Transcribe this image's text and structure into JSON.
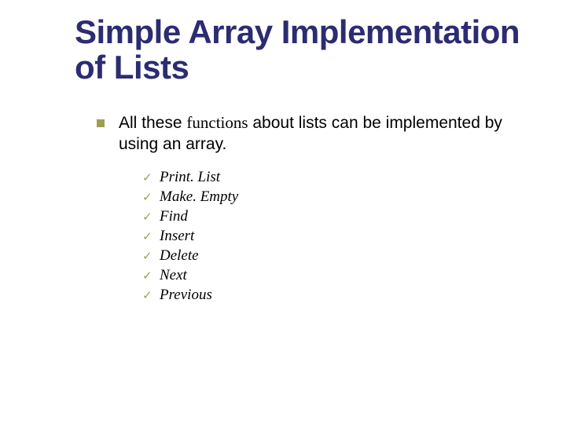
{
  "title": "Simple Array Implementation of Lists",
  "body_pre": "All these ",
  "body_serif": "functions",
  "body_post": " about lists can be implemented by using an array.",
  "bullet_glyph": "✓",
  "functions": {
    "f0": "Print. List",
    "f1": "Make. Empty",
    "f2": "Find",
    "f3": "Insert",
    "f4": "Delete",
    "f5": "Next",
    "f6": "Previous"
  }
}
